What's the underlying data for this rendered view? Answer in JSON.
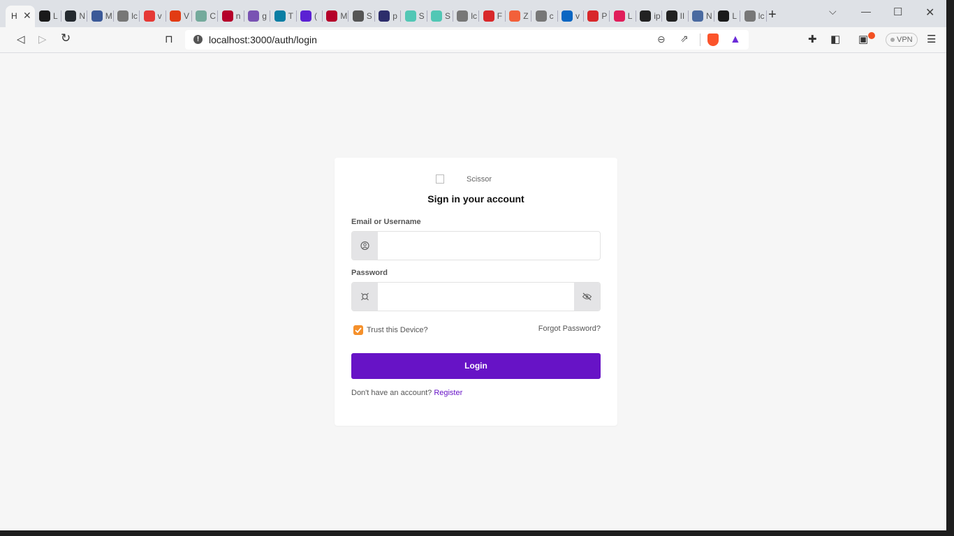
{
  "browser": {
    "active_tab_title": "H",
    "tabs": [
      {
        "label": "L",
        "icon": "mongodb-icon",
        "color": "#1a1a1a"
      },
      {
        "label": "N",
        "icon": "github-icon",
        "color": "#24292f"
      },
      {
        "label": "M",
        "icon": "app-icon",
        "color": "#3b5998"
      },
      {
        "label": "lc",
        "icon": "globe-icon",
        "color": "#777777"
      },
      {
        "label": "v",
        "icon": "heart-icon",
        "color": "#e53935"
      },
      {
        "label": "V",
        "icon": "alert-icon",
        "color": "#e23b13"
      },
      {
        "label": "C",
        "icon": "chatgpt-icon",
        "color": "#74aa9c"
      },
      {
        "label": "n",
        "icon": "m-icon",
        "color": "#b5002a"
      },
      {
        "label": "g",
        "icon": "bootstrap-icon",
        "color": "#7952b3"
      },
      {
        "label": "T",
        "icon": "react-icon",
        "color": "#0a7ea4"
      },
      {
        "label": "(",
        "icon": "mail-icon",
        "color": "#5b21d3"
      },
      {
        "label": "M",
        "icon": "m-icon",
        "color": "#b5002a"
      },
      {
        "label": "S",
        "icon": "gear-icon",
        "color": "#555555"
      },
      {
        "label": "p",
        "icon": "image-icon",
        "color": "#2d2d6b"
      },
      {
        "label": "S",
        "icon": "square-icon",
        "color": "#52c7b5"
      },
      {
        "label": "S",
        "icon": "square-icon",
        "color": "#52c7b5"
      },
      {
        "label": "lc",
        "icon": "globe-icon",
        "color": "#777777"
      },
      {
        "label": "F",
        "icon": "card-icon",
        "color": "#d8282a"
      },
      {
        "label": "Z",
        "icon": "z-icon",
        "color": "#f2603a"
      },
      {
        "label": "c",
        "icon": "globe-icon",
        "color": "#777777"
      },
      {
        "label": "v",
        "icon": "linkedin-icon",
        "color": "#0a66c2"
      },
      {
        "label": "P",
        "icon": "card-icon",
        "color": "#d8282a"
      },
      {
        "label": "L",
        "icon": "slack-icon",
        "color": "#e01e5a"
      },
      {
        "label": "ip",
        "icon": "globe-icon",
        "color": "#222222"
      },
      {
        "label": "II",
        "icon": "globe-icon",
        "color": "#222222"
      },
      {
        "label": "N",
        "icon": "robot-icon",
        "color": "#4a6aa0"
      },
      {
        "label": "L",
        "icon": "mongodb-icon",
        "color": "#1a1a1a"
      },
      {
        "label": "lc",
        "icon": "globe-icon",
        "color": "#777777"
      }
    ],
    "url": "localhost:3000/auth/login",
    "vpn_label": "VPN"
  },
  "login": {
    "logo_alt": "Scissor",
    "heading": "Sign in your account",
    "email_label": "Email or Username",
    "email_value": "",
    "password_label": "Password",
    "password_value": "",
    "trust_label": "Trust this Device?",
    "trust_checked": true,
    "forgot_label": "Forgot Password?",
    "login_button": "Login",
    "no_account_text": "Don't have an account?",
    "register_link": "Register",
    "accent_color": "#6713c6",
    "checkbox_color": "#f5902b"
  }
}
